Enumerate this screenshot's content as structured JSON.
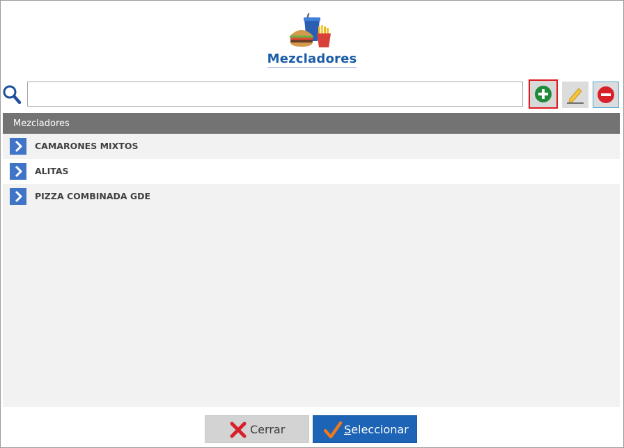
{
  "dialog": {
    "title": "Mezcladores"
  },
  "search": {
    "value": "",
    "placeholder": ""
  },
  "toolbar": {
    "add": "add",
    "edit": "edit",
    "delete": "delete"
  },
  "list": {
    "header": "Mezcladores",
    "items": [
      {
        "label": "CAMARONES MIXTOS"
      },
      {
        "label": "ALITAS"
      },
      {
        "label": "PIZZA COMBINADA GDE"
      }
    ]
  },
  "footer": {
    "close_label": "Cerrar",
    "select_label_first": "S",
    "select_label_rest": "eleccionar"
  },
  "colors": {
    "title": "#1a5ca8",
    "header_bg": "#737373",
    "select_button": "#1d63b6",
    "highlight": "#e0191f"
  }
}
